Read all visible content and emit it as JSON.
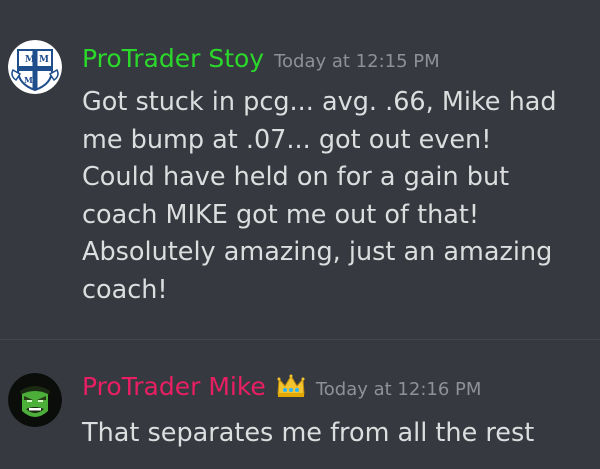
{
  "messages": [
    {
      "username": "ProTrader Stoy",
      "username_color": "#2bd92b",
      "timestamp": "Today at 12:15 PM",
      "avatar_icon": "shield-crest-avatar-icon",
      "lines": [
        "Got stuck in pcg... avg. .66, Mike had",
        "me bump at .07... got out even!",
        "Could have held on for a gain but",
        "coach MIKE got me out of that!",
        "Absolutely amazing, just an amazing",
        "coach!"
      ]
    },
    {
      "username": "ProTrader Mike",
      "username_color": "#e91e63",
      "timestamp": "Today at 12:16 PM",
      "avatar_icon": "hulk-face-avatar-icon",
      "badge_icon": "crown-icon",
      "lines": [
        "That separates me from all the rest"
      ]
    }
  ]
}
